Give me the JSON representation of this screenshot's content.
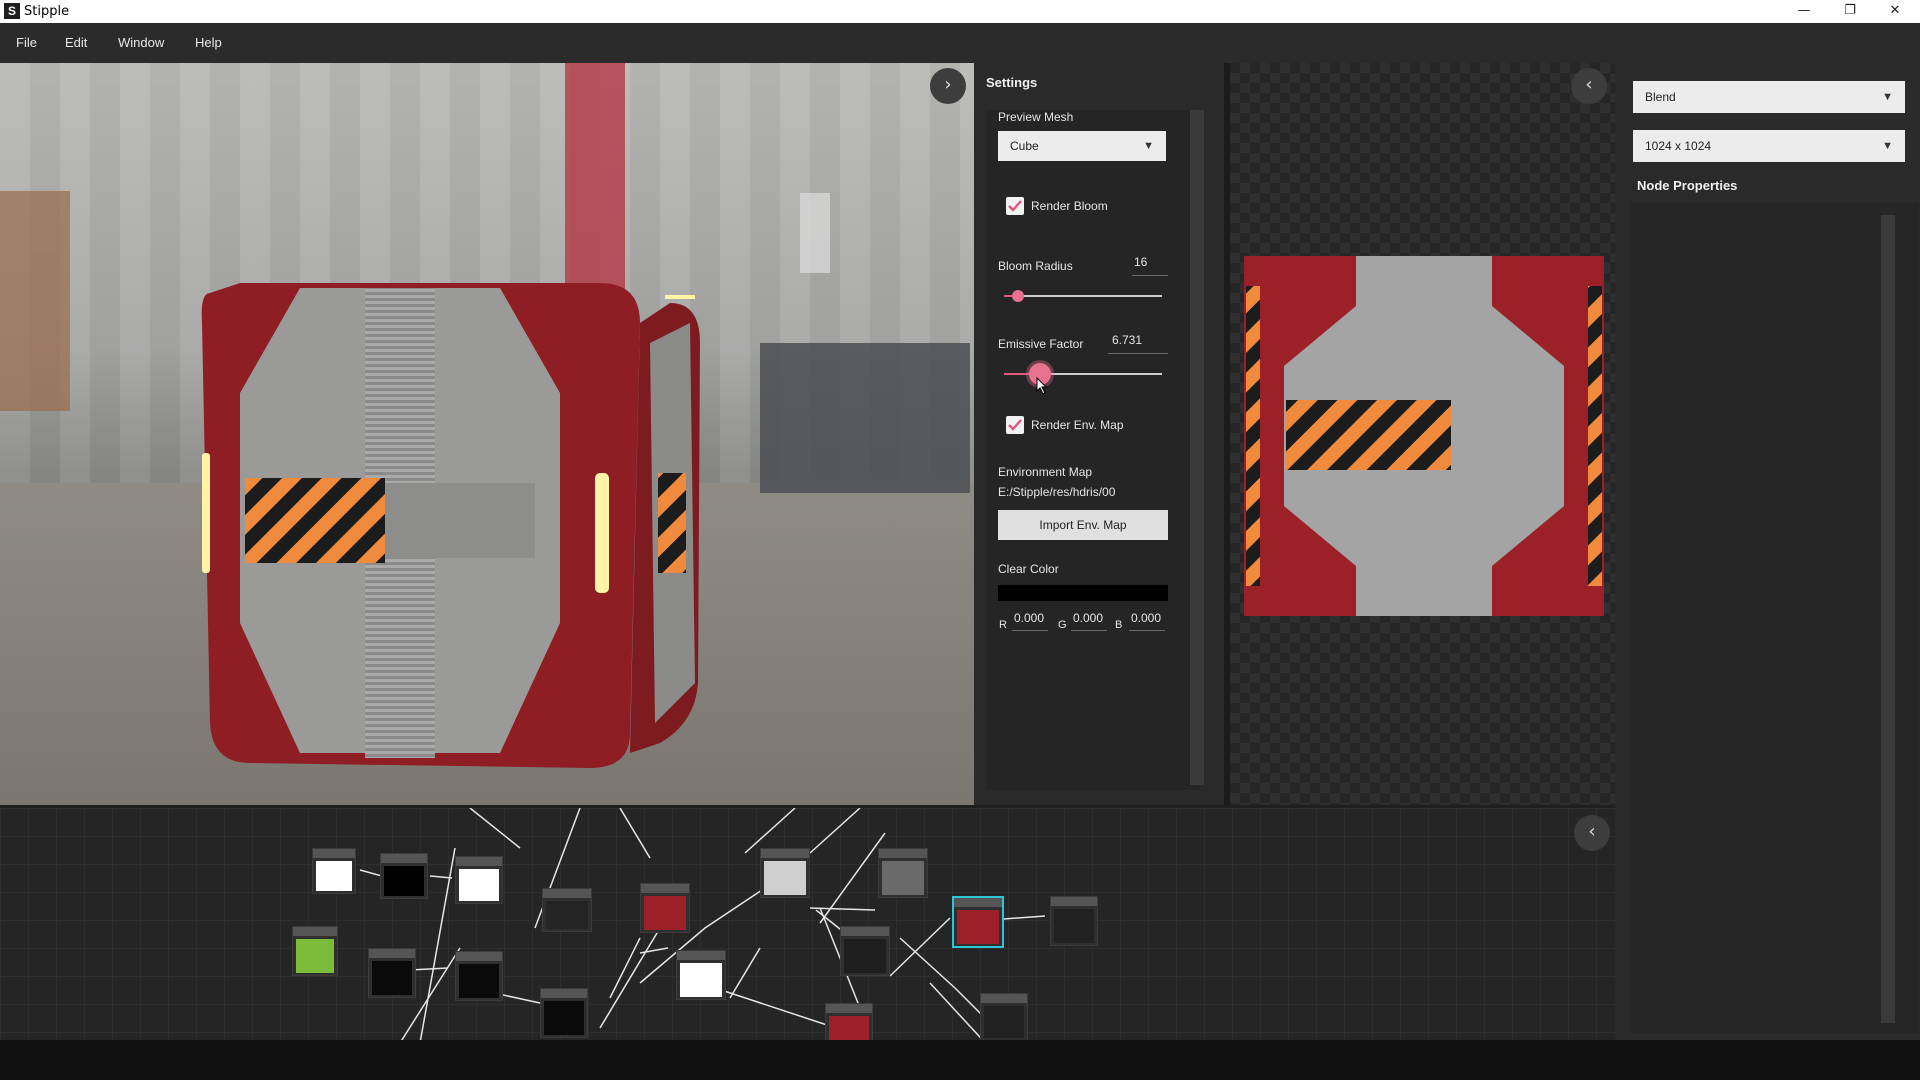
{
  "window": {
    "app_icon": "S",
    "title": "Stipple",
    "minimize_glyph": "—",
    "restore_glyph": "❐",
    "close_glyph": "✕"
  },
  "menu": {
    "items": [
      "File",
      "Edit",
      "Window",
      "Help"
    ]
  },
  "viewport": {
    "collapse_glyph": "›"
  },
  "settings": {
    "title": "Settings",
    "preview_mesh_label": "Preview Mesh",
    "preview_mesh_value": "Cube",
    "render_bloom_label": "Render Bloom",
    "render_bloom_checked": true,
    "bloom_radius_label": "Bloom Radius",
    "bloom_radius_value": "16",
    "bloom_radius_fraction": 0.09,
    "emissive_label": "Emissive Factor",
    "emissive_value": "6.731",
    "emissive_fraction": 0.23,
    "render_env_label": "Render Env. Map",
    "render_env_checked": true,
    "env_map_label": "Environment Map",
    "env_map_path": "E:/Stipple/res/hdris/00",
    "import_button": "Import Env. Map",
    "clear_color_label": "Clear Color",
    "clear_color": "#000000",
    "r_label": "R",
    "r_value": "0.000",
    "g_label": "G",
    "g_value": "0.000",
    "b_label": "B",
    "b_value": "0.000"
  },
  "preview": {
    "collapse_glyph": "‹"
  },
  "properties": {
    "node_type": "Blend",
    "resolution": "1024 x 1024",
    "section_title": "Node Properties"
  },
  "graph": {
    "collapse_glyph": "‹"
  },
  "colors": {
    "accent": "#e8728f",
    "selection": "#2ec4d6",
    "paint_red": "#9b2027",
    "hazard_orange": "#f08a3c"
  }
}
